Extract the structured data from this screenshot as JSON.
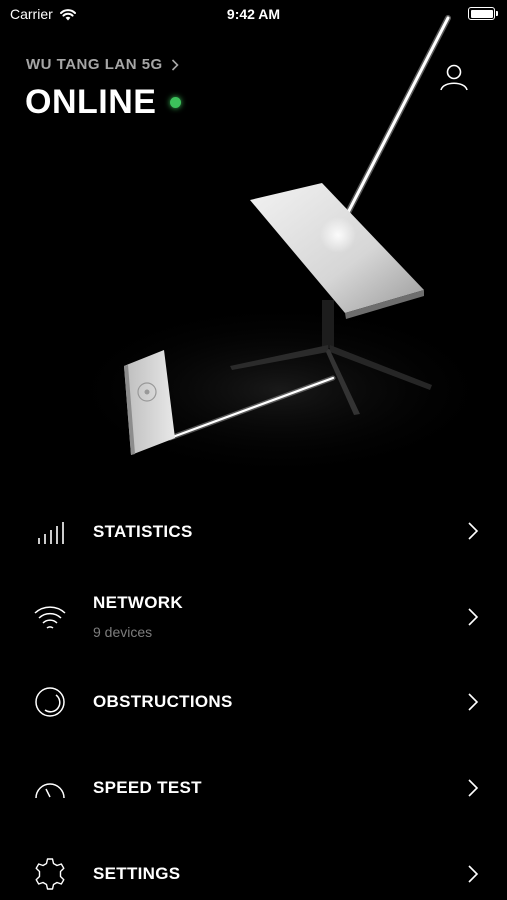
{
  "status_bar": {
    "carrier": "Carrier",
    "time": "9:42 AM"
  },
  "header": {
    "network_name": "WU TANG LAN 5G",
    "status": "ONLINE",
    "status_color": "#3cc15b"
  },
  "menu": [
    {
      "label": "STATISTICS",
      "icon": "bar-chart-icon"
    },
    {
      "label": "NETWORK",
      "subtitle": "9 devices",
      "icon": "wifi-icon"
    },
    {
      "label": "OBSTRUCTIONS",
      "icon": "obstruction-icon"
    },
    {
      "label": "SPEED TEST",
      "icon": "speedometer-icon"
    },
    {
      "label": "SETTINGS",
      "icon": "gear-icon"
    }
  ]
}
